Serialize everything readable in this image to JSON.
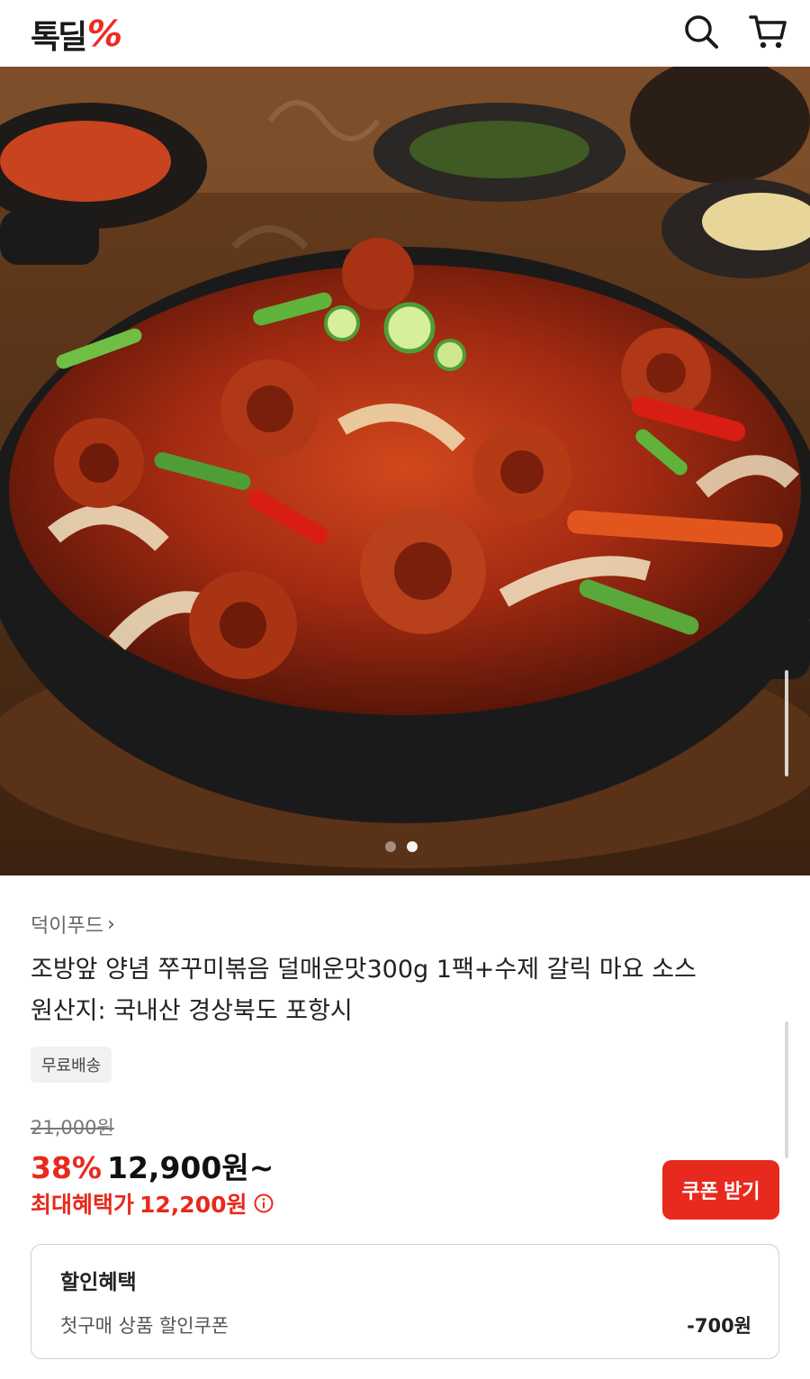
{
  "header": {
    "logo_text": "톡딜",
    "logo_mark": "%",
    "icons": {
      "search": "search-icon",
      "cart": "cart-icon"
    }
  },
  "hero": {
    "image_count": 2,
    "active_index": 1
  },
  "product": {
    "seller": "덕이푸드",
    "title_line1": "조방앞 양념 쭈꾸미볶음 덜매운맛300g 1팩+수제 갈릭 마요 소스",
    "title_line2": "원산지: 국내산 경상북도 포항시",
    "badge": "무료배송",
    "original_price": "21,000원",
    "discount_rate": "38%",
    "price": "12,900원~",
    "max_benefit_label": "최대혜택가",
    "max_benefit_price": "12,200원",
    "coupon_button": "쿠폰 받기"
  },
  "benefit_box": {
    "title": "할인혜택",
    "item_label": "첫구매 상품 할인쿠폰",
    "item_value": "-700원"
  },
  "colors": {
    "accent": "#e8291d",
    "logo_mark": "#ee2a24"
  }
}
